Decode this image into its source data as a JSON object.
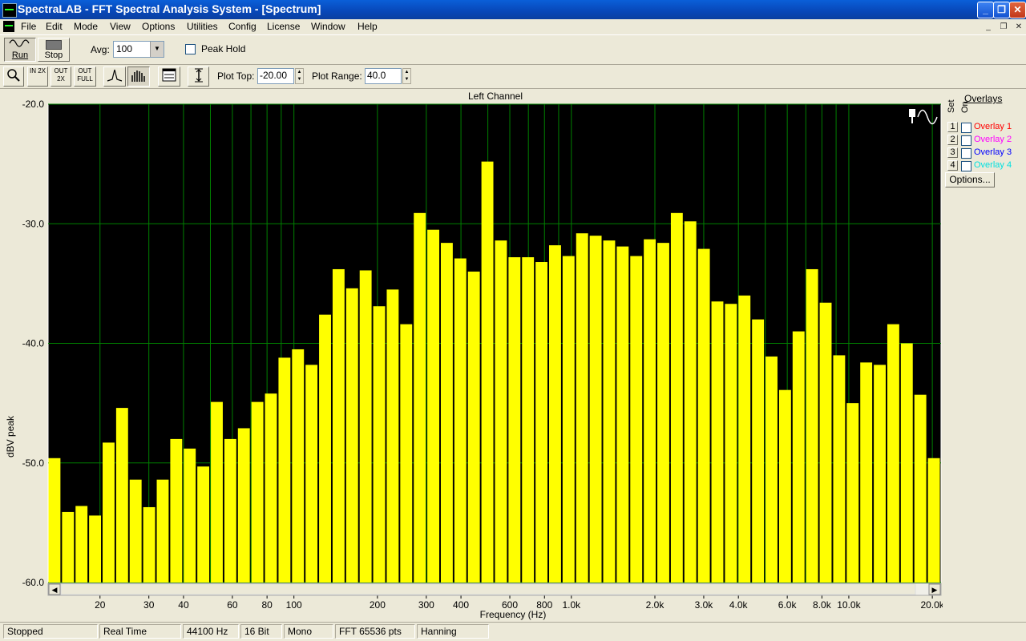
{
  "window": {
    "title": "SpectraLAB - FFT Spectral Analysis System - [Spectrum]"
  },
  "menu": [
    "File",
    "Edit",
    "Mode",
    "View",
    "Options",
    "Utilities",
    "Config",
    "License",
    "Window",
    "Help"
  ],
  "toolbar": {
    "run_label": "Run",
    "stop_label": "Stop",
    "avg_label": "Avg:",
    "avg_value": "100",
    "peak_hold_label": "Peak Hold",
    "zoom_in_label": "IN 2X",
    "zoom_out_label": "OUT 2X",
    "zoom_full_label": "OUT FULL",
    "plot_top_label": "Plot Top:",
    "plot_top_value": "-20.00",
    "plot_range_label": "Plot Range:",
    "plot_range_value": "40.0"
  },
  "overlays": {
    "title": "Overlays",
    "col_set": "Set",
    "col_on": "On",
    "items": [
      {
        "num": "1",
        "name": "Overlay 1",
        "color": "#ff0000"
      },
      {
        "num": "2",
        "name": "Overlay 2",
        "color": "#ff00ff"
      },
      {
        "num": "3",
        "name": "Overlay 3",
        "color": "#0000ff"
      },
      {
        "num": "4",
        "name": "Overlay 4",
        "color": "#00e0e0"
      }
    ],
    "options_label": "Options..."
  },
  "status": [
    "Stopped",
    "Real Time",
    "44100 Hz",
    "16 Bit",
    "Mono",
    "FFT 65536 pts",
    "Hanning"
  ],
  "chart_data": {
    "type": "bar",
    "title": "Left Channel",
    "xlabel": "Frequency (Hz)",
    "ylabel": "dBV peak",
    "xscale": "log",
    "xlim": [
      13,
      21500
    ],
    "ylim": [
      -60,
      -20
    ],
    "ytick_labels": [
      "-20.0",
      "-30.0",
      "-40.0",
      "-50.0",
      "-60.0"
    ],
    "xticks": [
      {
        "v": 20,
        "label": "20"
      },
      {
        "v": 30,
        "label": "30"
      },
      {
        "v": 40,
        "label": "40"
      },
      {
        "v": 60,
        "label": "60"
      },
      {
        "v": 80,
        "label": "80"
      },
      {
        "v": 100,
        "label": "100"
      },
      {
        "v": 200,
        "label": "200"
      },
      {
        "v": 300,
        "label": "300"
      },
      {
        "v": 400,
        "label": "400"
      },
      {
        "v": 600,
        "label": "600"
      },
      {
        "v": 800,
        "label": "800"
      },
      {
        "v": 1000,
        "label": "1.0k"
      },
      {
        "v": 2000,
        "label": "2.0k"
      },
      {
        "v": 3000,
        "label": "3.0k"
      },
      {
        "v": 4000,
        "label": "4.0k"
      },
      {
        "v": 6000,
        "label": "6.0k"
      },
      {
        "v": 8000,
        "label": "8.0k"
      },
      {
        "v": 10000,
        "label": "10.0k"
      },
      {
        "v": 20000,
        "label": "20.0k"
      }
    ],
    "grid": true,
    "bar_color": "#ffff00",
    "background": "#000000",
    "grid_color": "#008000",
    "values": [
      -49.6,
      -54.1,
      -53.6,
      -54.4,
      -48.3,
      -45.4,
      -51.4,
      -53.7,
      -51.4,
      -48.0,
      -48.8,
      -50.3,
      -44.9,
      -48.0,
      -47.1,
      -44.9,
      -44.2,
      -41.2,
      -40.5,
      -41.8,
      -37.6,
      -33.8,
      -35.4,
      -33.9,
      -36.9,
      -35.5,
      -38.4,
      -29.1,
      -30.5,
      -31.6,
      -32.9,
      -34.0,
      -24.8,
      -31.4,
      -32.8,
      -32.8,
      -33.2,
      -31.8,
      -32.7,
      -30.8,
      -31.0,
      -31.4,
      -31.9,
      -32.7,
      -31.3,
      -31.6,
      -29.1,
      -29.8,
      -32.1,
      -36.5,
      -36.7,
      -36.0,
      -38.0,
      -41.1,
      -43.9,
      -39.0,
      -33.8,
      -36.6,
      -41.0,
      -45.0,
      -41.6,
      -41.8,
      -38.4,
      -40.0,
      -44.3,
      -49.6
    ]
  }
}
